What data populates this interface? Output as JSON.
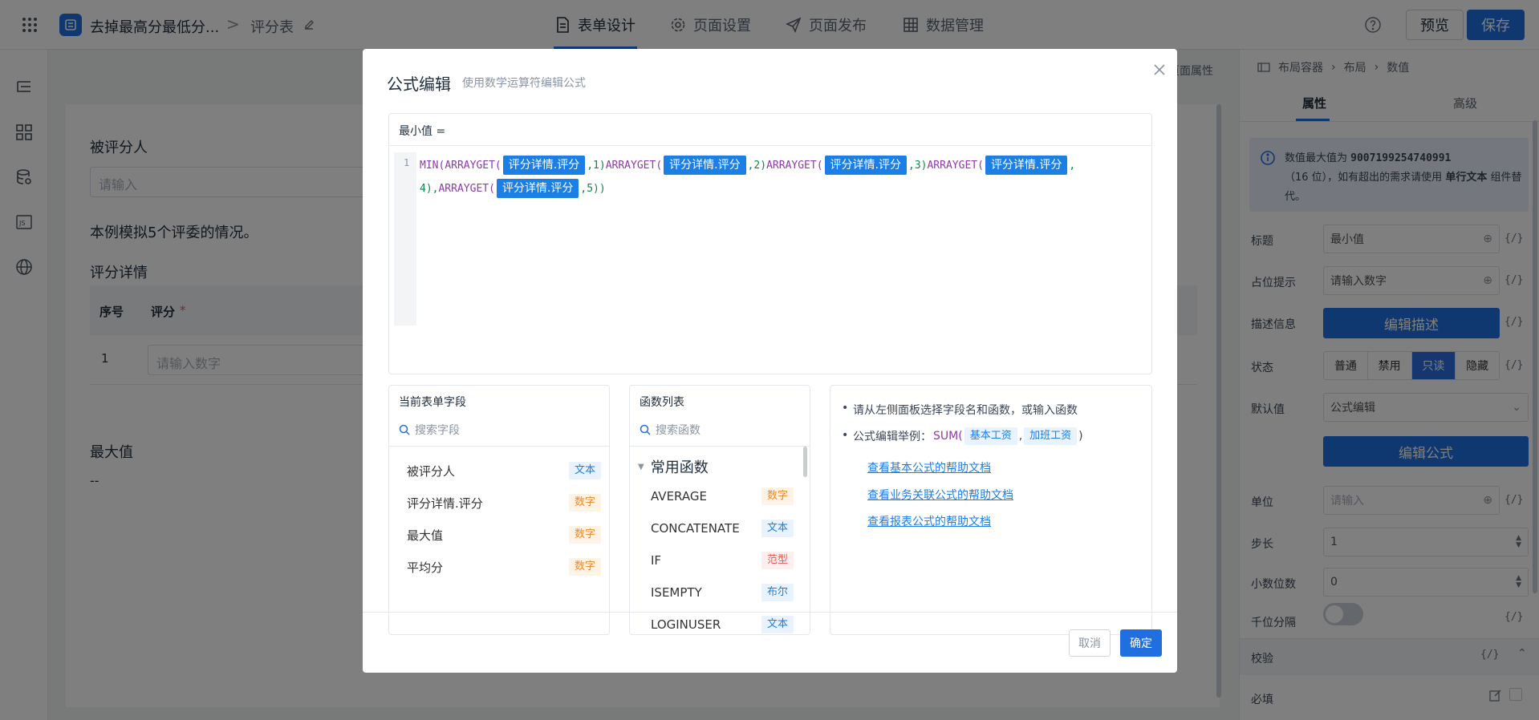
{
  "topbar": {
    "app_title": "去掉最高分最低分...",
    "breadcrumb_sep": ">",
    "page_name": "评分表",
    "tabs": [
      {
        "label": "表单设计",
        "icon": "form-icon",
        "active": true
      },
      {
        "label": "页面设置",
        "icon": "gear-icon",
        "active": false
      },
      {
        "label": "页面发布",
        "icon": "send-icon",
        "active": false
      },
      {
        "label": "数据管理",
        "icon": "table-icon",
        "active": false
      }
    ],
    "help_icon": "help-circle-icon",
    "preview_label": "预览",
    "save_label": "保存"
  },
  "canvas": {
    "page_props_label": "页面属性",
    "reviewee_label": "被评分人",
    "reviewee_placeholder": "请输入",
    "note": "本例模拟5个评委的情况。",
    "detail_title": "评分详情",
    "table": {
      "col_index": "序号",
      "col_score": "评分",
      "required_mark": "*",
      "row_index": "1",
      "row_placeholder": "请输入数字"
    },
    "max_label": "最大值",
    "max_value": "--"
  },
  "rightpanel": {
    "breadcrumb": [
      "布局容器",
      "布局",
      "数值"
    ],
    "tabs": [
      "属性",
      "高级"
    ],
    "info_line1_prefix": "数值最大值为",
    "info_max": "9007199254740991",
    "info_line2": "（16 位），如有超出的需求请使用",
    "info_bold": "单行文本",
    "info_line3": "组件替代。",
    "fx": "{/}",
    "title_label": "标题",
    "title_value": "最小值",
    "placeholder_label": "占位提示",
    "placeholder_value": "请输入数字",
    "desc_label": "描述信息",
    "desc_button": "编辑描述",
    "state_label": "状态",
    "state_options": [
      "普通",
      "禁用",
      "只读",
      "隐藏"
    ],
    "state_selected": "只读",
    "default_label": "默认值",
    "default_value": "公式编辑",
    "formula_button": "编辑公式",
    "unit_label": "单位",
    "unit_placeholder": "请输入",
    "step_label": "步长",
    "step_value": "1",
    "decimal_label": "小数位数",
    "decimal_value": "0",
    "thousands_label": "千位分隔",
    "validate_label": "校验",
    "required_label": "必填"
  },
  "modal": {
    "title": "公式编辑",
    "subtitle": "使用数学运算符编辑公式",
    "formula_label": "最小值 =",
    "line_number": "1",
    "code": {
      "fn_min": "MIN(",
      "fn_arrayget": "ARRAYGET(",
      "field": "评分详情.评分",
      "args": [
        ",1)",
        ",2)",
        ",3)",
        ","
      ],
      "line2_start": "4),",
      "line2_end": ",5))"
    },
    "fields_panel": {
      "title": "当前表单字段",
      "search_placeholder": "搜索字段",
      "items": [
        {
          "name": "被评分人",
          "type": "文本",
          "kind": "text"
        },
        {
          "name": "评分详情.评分",
          "type": "数字",
          "kind": "num"
        },
        {
          "name": "最大值",
          "type": "数字",
          "kind": "num"
        },
        {
          "name": "平均分",
          "type": "数字",
          "kind": "num"
        }
      ]
    },
    "functions_panel": {
      "title": "函数列表",
      "search_placeholder": "搜索函数",
      "group": "常用函数",
      "items": [
        {
          "name": "AVERAGE",
          "type": "数字",
          "kind": "num"
        },
        {
          "name": "CONCATENATE",
          "type": "文本",
          "kind": "text"
        },
        {
          "name": "IF",
          "type": "范型",
          "kind": "fan"
        },
        {
          "name": "ISEMPTY",
          "type": "布尔",
          "kind": "bool"
        },
        {
          "name": "LOGINUSER",
          "type": "文本",
          "kind": "text"
        }
      ]
    },
    "help_panel": {
      "tip1": "请从左侧面板选择字段名和函数，或输入函数",
      "tip2_prefix": "公式编辑举例：",
      "tip2_fn": "SUM(",
      "tip2_arg1": "基本工资",
      "tip2_sep": ",",
      "tip2_arg2": "加班工资",
      "tip2_end": ")",
      "links": [
        "查看基本公式的帮助文档",
        "查看业务关联公式的帮助文档",
        "查看报表公式的帮助文档"
      ]
    },
    "cancel_label": "取消",
    "confirm_label": "确定"
  }
}
